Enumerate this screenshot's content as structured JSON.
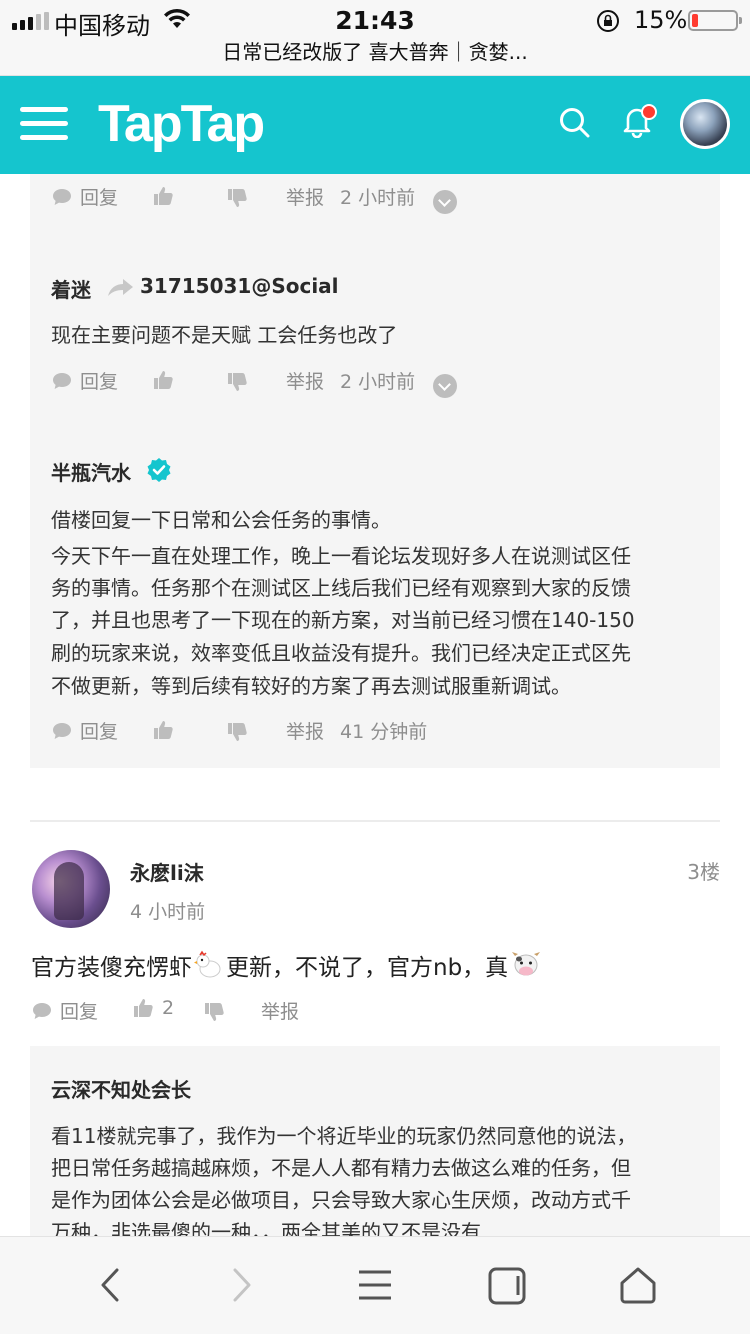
{
  "status_bar": {
    "carrier": "中国移动",
    "time": "21:43",
    "battery_percent": "15%",
    "battery_level": 0.15
  },
  "browser": {
    "page_title": "日常已经改版了 喜大普奔｜贪婪..."
  },
  "header": {
    "logo": "TapTap",
    "accent_color": "#15c5ce"
  },
  "replies": [
    {
      "actions": {
        "reply": "回复",
        "report": "举报",
        "time": "2 小时前"
      }
    },
    {
      "author": "着迷",
      "reply_to": "31715031@Social",
      "text": "现在主要问题不是天赋 工会任务也改了",
      "actions": {
        "reply": "回复",
        "report": "举报",
        "time": "2 小时前"
      }
    },
    {
      "author": "半瓶汽水",
      "verified": true,
      "text_lines": [
        "借楼回复一下日常和公会任务的事情。",
        "今天下午一直在处理工作，晚上一看论坛发现好多人在说测试区任",
        "务的事情。任务那个在测试区上线后我们已经有观察到大家的反馈",
        "了，并且也思考了一下现在的新方案，对当前已经习惯在140-150",
        "刷的玩家来说，效率变低且收益没有提升。我们已经决定正式区先",
        "不做更新，等到后续有较好的方案了再去测试服重新调试。"
      ],
      "actions": {
        "reply": "回复",
        "report": "举报",
        "time": "41 分钟前"
      }
    }
  ],
  "post": {
    "author": "永麽li沫",
    "time": "4 小时前",
    "floor": "3楼",
    "text_a": "官方装傻充愣虾",
    "text_b": "更新，不说了，官方nb，真",
    "actions": {
      "reply": "回复",
      "likes": "2",
      "report": "举报"
    }
  },
  "sub_reply": {
    "author": "云深不知处会长",
    "text_lines": [
      "看11楼就完事了，我作为一个将近毕业的玩家仍然同意他的说法，",
      "把日常任务越搞越麻烦，不是人人都有精力去做这么难的任务，但",
      "是作为团体公会是必做项目，只会导致大家心生厌烦，改动方式千",
      "万种，非选最傻的一种，，两全其美的又不是没有"
    ]
  }
}
